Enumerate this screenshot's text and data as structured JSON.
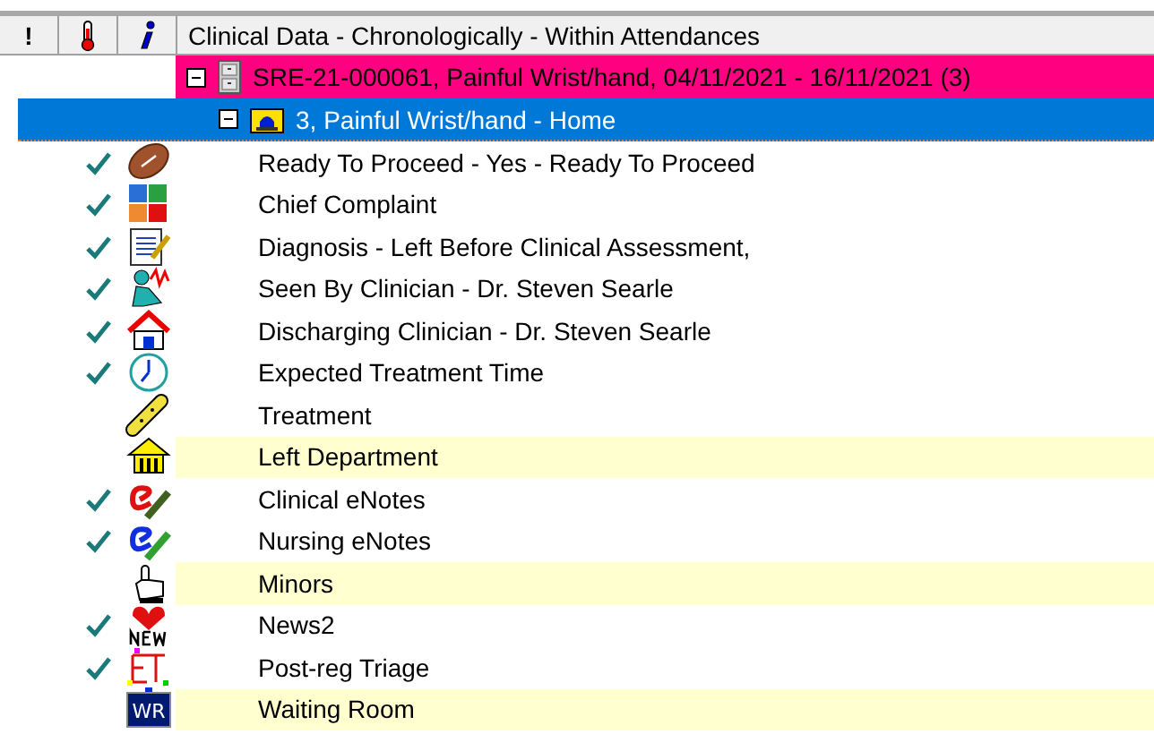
{
  "header": {
    "flag_column": "!",
    "title": "Clinical Data - Chronologically - Within Attendances"
  },
  "attendance": {
    "label": "SRE-21-000061, Painful Wrist/hand, 04/11/2021 - 16/11/2021 (3)",
    "expanded": true,
    "episode": {
      "label": "3, Painful Wrist/hand - Home",
      "expanded": true,
      "selected": true,
      "items": [
        {
          "kind": "football",
          "label": "Ready To Proceed - Yes - Ready To Proceed",
          "checked": true,
          "highlighted": false
        },
        {
          "kind": "scores",
          "label": "Chief Complaint",
          "checked": true,
          "highlighted": false
        },
        {
          "kind": "notepad",
          "label": "Diagnosis - Left Before Clinical Assessment,",
          "checked": true,
          "highlighted": false
        },
        {
          "kind": "clinician",
          "label": "Seen By Clinician - Dr. Steven Searle",
          "checked": true,
          "highlighted": false
        },
        {
          "kind": "house",
          "label": "Discharging Clinician - Dr. Steven Searle",
          "checked": true,
          "highlighted": false
        },
        {
          "kind": "clock",
          "label": "Expected Treatment Time",
          "checked": true,
          "highlighted": false
        },
        {
          "kind": "bandage",
          "label": "Treatment",
          "checked": false,
          "highlighted": false
        },
        {
          "kind": "building",
          "label": "Left Department",
          "checked": false,
          "highlighted": true
        },
        {
          "kind": "rednote",
          "label": "Clinical eNotes",
          "checked": true,
          "highlighted": false
        },
        {
          "kind": "bluenote",
          "label": "Nursing eNotes",
          "checked": true,
          "highlighted": false
        },
        {
          "kind": "pointer",
          "label": "Minors",
          "checked": false,
          "highlighted": true
        },
        {
          "kind": "heart",
          "label": "News2",
          "checked": true,
          "highlighted": false
        },
        {
          "kind": "triage",
          "label": "Post-reg Triage",
          "checked": true,
          "highlighted": false
        },
        {
          "kind": "board",
          "badge_text": "WR",
          "label": "Waiting Room",
          "checked": false,
          "highlighted": true
        }
      ]
    }
  }
}
